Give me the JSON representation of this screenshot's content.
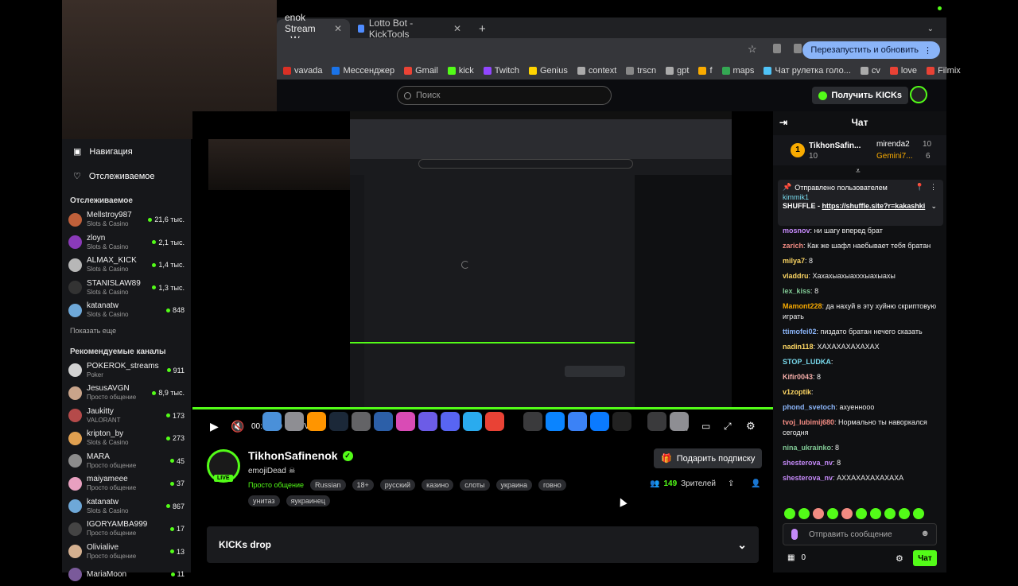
{
  "browser": {
    "tabs": [
      {
        "label": "enok Stream - W"
      },
      {
        "label": "Lotto Bot - KickTools"
      }
    ],
    "restart_label": "Перезапустить и обновить",
    "bookmarks": [
      "vavada",
      "Мессенджер",
      "Gmail",
      "kick",
      "Twitch",
      "Genius",
      "context",
      "trscn",
      "gpt",
      "f",
      "maps",
      "Чат рулетка голо...",
      "cv",
      "love",
      "Filmix"
    ]
  },
  "kick_header": {
    "search_placeholder": "Поиск",
    "get_kicks_label": "Получить KICKs"
  },
  "sidebar": {
    "nav": [
      {
        "label": "Навигация"
      },
      {
        "label": "Отслеживаемое"
      }
    ],
    "followed_title": "Отслеживаемое",
    "followed": [
      {
        "name": "Mellstroy987",
        "category": "Slots & Casino",
        "count": "21,6 тыс."
      },
      {
        "name": "zloyn",
        "category": "Slots & Casino",
        "count": "2,1 тыс."
      },
      {
        "name": "ALMAX_KICK",
        "category": "Slots & Casino",
        "count": "1,4 тыс."
      },
      {
        "name": "STANISLAW89",
        "category": "Slots & Casino",
        "count": "1,3 тыс."
      },
      {
        "name": "katanatw",
        "category": "Slots & Casino",
        "count": "848"
      }
    ],
    "show_more": "Показать еще",
    "recommended_title": "Рекомендуемые каналы",
    "recommended": [
      {
        "name": "POKEROK_streams",
        "category": "Poker",
        "count": "911"
      },
      {
        "name": "JesusAVGN",
        "category": "Просто общение",
        "count": "8,9 тыс."
      },
      {
        "name": "Jaukitty",
        "category": "VALORANT",
        "count": "173"
      },
      {
        "name": "kripton_by",
        "category": "Slots & Casino",
        "count": "273"
      },
      {
        "name": "MARA",
        "category": "Просто общение",
        "count": "45"
      },
      {
        "name": "maiyameee",
        "category": "Просто общение",
        "count": "37"
      },
      {
        "name": "katanatw",
        "category": "Slots & Casino",
        "count": "867"
      },
      {
        "name": "IGORYAMBA999",
        "category": "Просто общение",
        "count": "17"
      },
      {
        "name": "Olivialive",
        "category": "Просто общение",
        "count": "13"
      },
      {
        "name": "MariaMoon",
        "category": "",
        "count": "11"
      }
    ]
  },
  "player": {
    "time": "00:03:29",
    "live_label": "LIVE",
    "progress": 1.0
  },
  "stream": {
    "streamer": "TikhonSafinenok",
    "title": "emojiDead ☠",
    "live_badge": "LIVE",
    "category": "Просто общение",
    "tags": [
      "Russian",
      "18+",
      "русский",
      "казино",
      "слоты",
      "украина",
      "говно",
      "унитаз",
      "яукраинец"
    ],
    "gift_label": "Подарить подписку",
    "viewers_count": "149",
    "viewers_label": "Зрителей"
  },
  "kicks_drop": {
    "label": "KICKs drop"
  },
  "chat": {
    "title": "Чат",
    "leaders": [
      {
        "name": "TikhonSafin...",
        "value": "10"
      },
      {
        "name": "mirenda2",
        "value": "10"
      },
      {
        "name": "Gemini7...",
        "value": "6"
      }
    ],
    "pinned_title": "Отправлено пользователем",
    "pinned_user": "kimmik1",
    "pinned_text": "SHUFFLE - ",
    "pinned_link": "https://shuffle.site?r=kakashki",
    "messages": [
      {
        "user": "mosnov",
        "text": "ни шагу вперед брат",
        "color": "#c58af9"
      },
      {
        "user": "zarich",
        "text": "Как же шафл наебывает тебя братан",
        "color": "#f28b82"
      },
      {
        "user": "milya7",
        "text": "8",
        "color": "#fdd663"
      },
      {
        "user": "vladdru",
        "text": "Хахахыахыахххыахыахы",
        "color": "#fdd663"
      },
      {
        "user": "lex_kiss",
        "text": "8",
        "color": "#81c995"
      },
      {
        "user": "Mamont228",
        "text": "да нахуй в эту хуйню скриптовую играть",
        "color": "#f9ab00"
      },
      {
        "user": "ttimofei02",
        "text": "пиздато братан нечего сказать",
        "color": "#8ab4f8"
      },
      {
        "user": "nadin118",
        "text": "ХАХАХАХАХАХАХ",
        "color": "#fdd663"
      },
      {
        "user": "STOP_LUDKA",
        "text": "",
        "color": "#78d9ec"
      },
      {
        "user": "Kifir0043",
        "text": "8",
        "color": "#f6aea9"
      },
      {
        "user": "v1zoptik",
        "text": "",
        "color": "#fdd663"
      },
      {
        "user": "phond_svetoch",
        "text": "ахуеннооо",
        "color": "#8ab4f8"
      },
      {
        "user": "tvoj_lubimij680",
        "text": "Нормально ты наворкался сегодня",
        "color": "#f28b82"
      },
      {
        "user": "nina_ukrainko",
        "text": "8",
        "color": "#81c995"
      },
      {
        "user": "shesterova_nv",
        "text": "8",
        "color": "#c58af9"
      },
      {
        "user": "shesterova_nv",
        "text": "АХХАХАХАХАХАХА",
        "color": "#c58af9"
      }
    ],
    "input_placeholder": "Отправить сообщение",
    "points": "0",
    "send_label": "Чат"
  }
}
